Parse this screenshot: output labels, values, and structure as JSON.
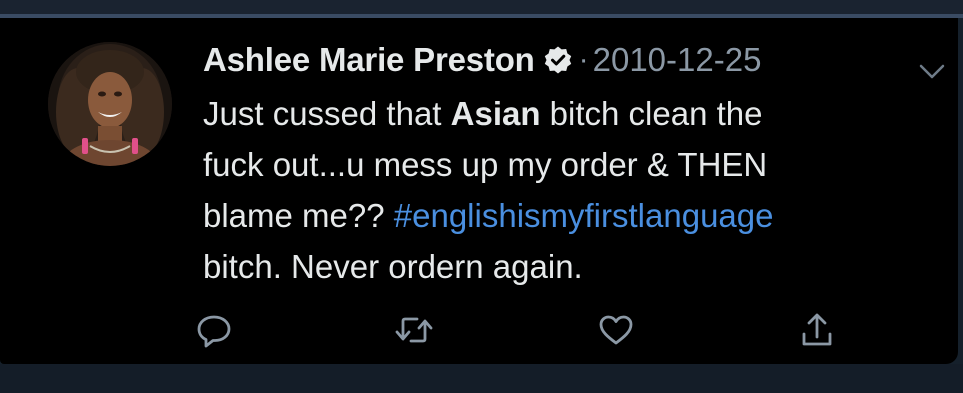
{
  "tweet": {
    "display_name": "Ashlee Marie Preston",
    "separator": "·",
    "date": "2010-12-25",
    "text_part1": "Just cussed that ",
    "text_bold": "Asian",
    "text_part2": " bitch clean the",
    "text_line2": "fuck out...u mess up my order & THEN",
    "text_line3": "blame me?? ",
    "hashtag": "#englishismyfirstlanguage",
    "text_line4": "bitch. Never ordern again."
  },
  "colors": {
    "background": "#000000",
    "text": "#e6e9ea",
    "secondary": "#8b98a5",
    "hashtag": "#4a8fe0"
  },
  "icons": {
    "verified": "verified-badge-icon",
    "caret": "chevron-down-icon",
    "reply": "reply-icon",
    "retweet": "retweet-icon",
    "like": "heart-icon",
    "share": "share-icon"
  }
}
